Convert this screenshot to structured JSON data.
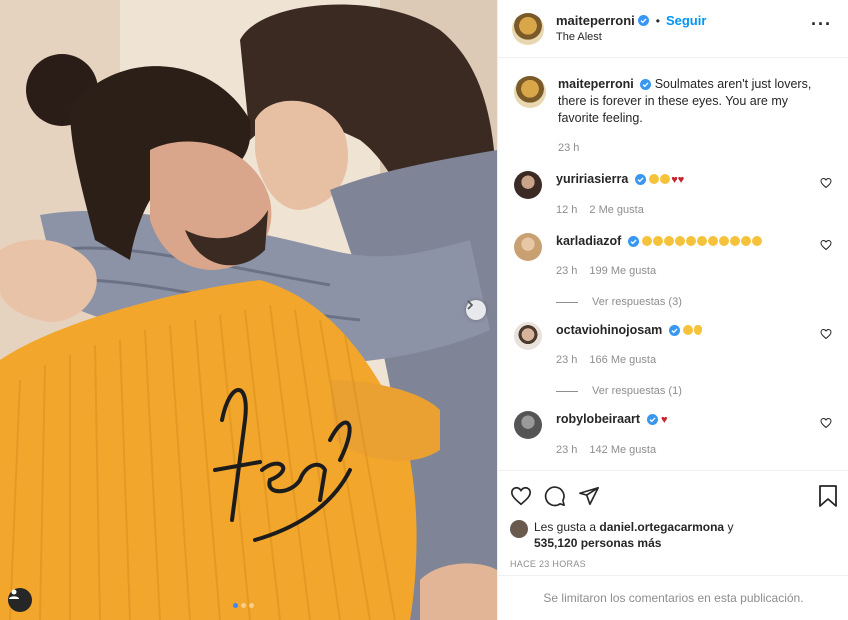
{
  "post": {
    "author": "maiteperroni",
    "follow_label": "Seguir",
    "location": "The Alest",
    "caption": "Soulmates aren't just lovers, there is forever in these eyes. You are my favorite feeling.",
    "caption_time": "23 h"
  },
  "comments": [
    {
      "user": "yuririasierra",
      "time": "12 h",
      "likes": "2 Me gusta"
    },
    {
      "user": "karladiazof",
      "time": "23 h",
      "likes": "199 Me gusta",
      "replies": "Ver respuestas (3)"
    },
    {
      "user": "octaviohinojosam",
      "time": "23 h",
      "likes": "166 Me gusta",
      "replies": "Ver respuestas (1)"
    },
    {
      "user": "robylobeiraart",
      "time": "23 h",
      "likes": "142 Me gusta"
    }
  ],
  "likes": {
    "prefix": "Les gusta a",
    "user": "daniel.ortegacarmona",
    "connector": "y",
    "count": "535,120 personas más"
  },
  "time_ago": "HACE 23 HORAS",
  "comments_limited": "Se limitaron los comentarios en esta publicación.",
  "colors": {
    "accent": "#0095f6",
    "verified": "#3897f0",
    "heart": "#c8232c"
  },
  "carousel": {
    "slides": 3,
    "active": 1
  }
}
